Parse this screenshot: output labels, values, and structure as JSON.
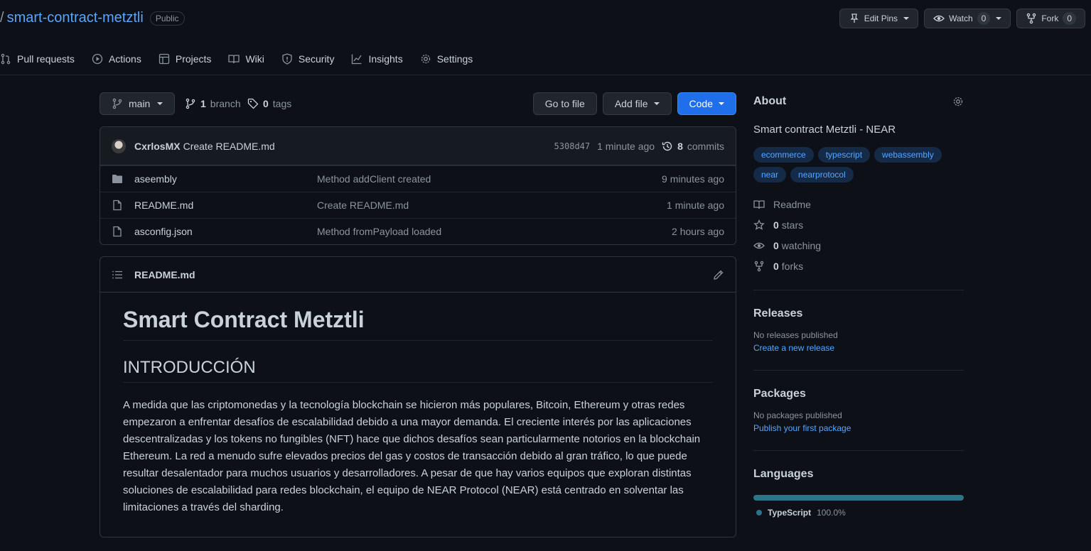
{
  "repo": {
    "slash": "/",
    "name": "smart-contract-metztli",
    "visibility": "Public"
  },
  "header_actions": {
    "edit_pins": "Edit Pins",
    "watch": "Watch",
    "watch_count": "0",
    "fork": "Fork",
    "fork_count": "0"
  },
  "nav": [
    {
      "label": "Pull requests",
      "icon": "pull-request-icon"
    },
    {
      "label": "Actions",
      "icon": "play-icon"
    },
    {
      "label": "Projects",
      "icon": "table-icon"
    },
    {
      "label": "Wiki",
      "icon": "book-icon"
    },
    {
      "label": "Security",
      "icon": "shield-icon"
    },
    {
      "label": "Insights",
      "icon": "graph-icon"
    },
    {
      "label": "Settings",
      "icon": "gear-icon"
    }
  ],
  "toolbar": {
    "branch": "main",
    "branch_count": "1",
    "branch_label": "branch",
    "tag_count": "0",
    "tag_label": "tags",
    "go_to_file": "Go to file",
    "add_file": "Add file",
    "code": "Code"
  },
  "latest_commit": {
    "author": "CxrlosMX",
    "message": "Create README.md",
    "sha": "5308d47",
    "time": "1 minute ago",
    "commit_count": "8",
    "commit_label": "commits"
  },
  "files": [
    {
      "name": "aseembly",
      "type": "folder",
      "message": "Method addClient created",
      "age": "9 minutes ago"
    },
    {
      "name": "README.md",
      "type": "file",
      "message": "Create README.md",
      "age": "1 minute ago"
    },
    {
      "name": "asconfig.json",
      "type": "file",
      "message": "Method fromPayload loaded",
      "age": "2 hours ago"
    }
  ],
  "readme": {
    "filename": "README.md",
    "h1": "Smart Contract Metztli",
    "h2": "INTRODUCCIÓN",
    "paragraph": "A medida que las criptomonedas y la tecnología blockchain se hicieron más populares, Bitcoin, Ethereum y otras redes empezaron a enfrentar desafíos de escalabilidad debido a una mayor demanda. El creciente interés por las aplicaciones descentralizadas y los tokens no fungibles (NFT) hace que dichos desafíos sean particularmente notorios en la blockchain Ethereum. La red a menudo sufre elevados precios del gas y costos de transacción debido al gran tráfico, lo que puede resultar desalentador para muchos usuarios y desarrolladores. A pesar de que hay varios equipos que exploran distintas soluciones de escalabilidad para redes blockchain, el equipo de NEAR Protocol (NEAR) está centrado en solventar las limitaciones a través del sharding."
  },
  "about": {
    "title": "About",
    "description": "Smart contract Metztli - NEAR",
    "topics": [
      "ecommerce",
      "typescript",
      "webassembly",
      "near",
      "nearprotocol"
    ],
    "readme_label": "Readme",
    "stars_count": "0",
    "stars_label": "stars",
    "watching_count": "0",
    "watching_label": "watching",
    "forks_count": "0",
    "forks_label": "forks"
  },
  "releases": {
    "title": "Releases",
    "empty": "No releases published",
    "link": "Create a new release"
  },
  "packages": {
    "title": "Packages",
    "empty": "No packages published",
    "link": "Publish your first package"
  },
  "languages": {
    "title": "Languages",
    "items": [
      {
        "name": "TypeScript",
        "percent": "100.0%",
        "color": "#2b7489",
        "fraction": 1.0
      }
    ]
  }
}
